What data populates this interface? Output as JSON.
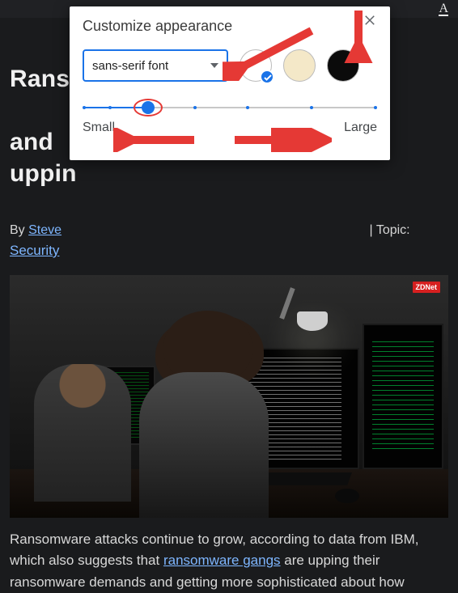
{
  "toolbar": {
    "text_tool": "A"
  },
  "article": {
    "headline_left": "Rans",
    "headline_right": "and",
    "headline_line2": "uppin",
    "byline_prefix": "By ",
    "author": "Steve",
    "topic_label": " Topic:",
    "topic_link": "Security",
    "body_part1": "Ransomware attacks continue to grow, according to data from IBM, which also suggests that ",
    "body_link": "ransomware gangs",
    "body_part2": " are upping their ransomware demands and getting more sophisticated about how",
    "hero_logo": "ZDNet"
  },
  "popup": {
    "title": "Customize appearance",
    "font_value": "sans-serif font",
    "themes": {
      "light": {
        "color": "#ffffff",
        "selected": true
      },
      "sepia": {
        "color": "#f4e8c8",
        "selected": false
      },
      "dark": {
        "color": "#0b0b0b",
        "selected": false
      }
    },
    "slider": {
      "small_label": "Small",
      "large_label": "Large",
      "value_percent": 22,
      "ticks_percent": [
        0,
        9,
        22,
        38,
        56,
        78,
        100
      ]
    }
  },
  "colors": {
    "accent": "#1a73e8",
    "annotation": "#e53935",
    "link": "#7eb6ff",
    "bg_dark": "#1a1b1d"
  }
}
